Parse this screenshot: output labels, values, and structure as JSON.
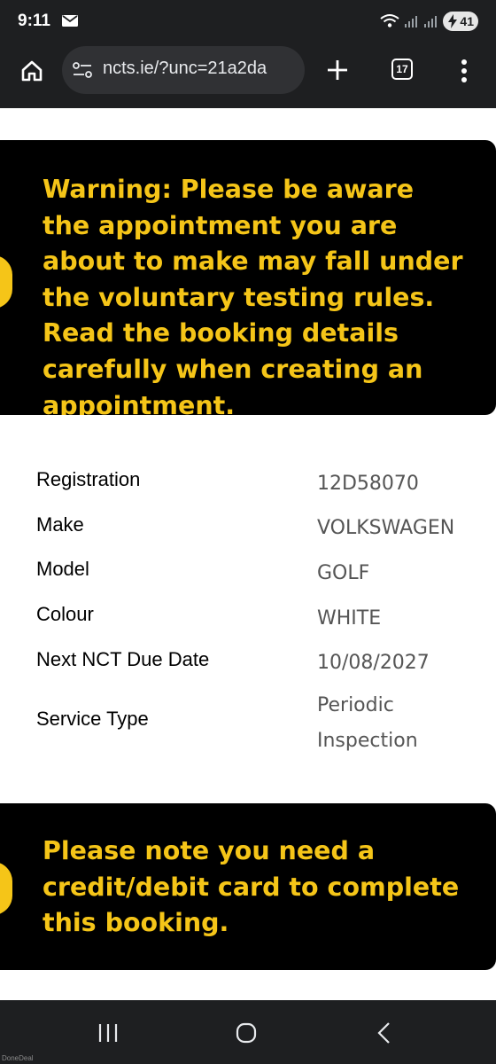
{
  "status_bar": {
    "time": "9:11",
    "battery": "41",
    "icons": [
      "mail-icon",
      "wifi-icon",
      "signal-icon",
      "signal-icon",
      "battery-icon"
    ]
  },
  "browser": {
    "url": "ncts.ie/?unc=21a2da",
    "tab_count": "17",
    "icons": [
      "home-icon",
      "site-settings-icon",
      "new-tab-icon",
      "tabs-counter",
      "menu-icon"
    ]
  },
  "warning": {
    "text": "Warning: Please be aware the appointment you are about to make may fall under the voluntary testing rules. Read the booking details carefully when creating an appointment."
  },
  "details": [
    {
      "label": "Registration",
      "value": "12D58070"
    },
    {
      "label": "Make",
      "value": "VOLKSWAGEN"
    },
    {
      "label": "Model",
      "value": "GOLF"
    },
    {
      "label": "Colour",
      "value": "WHITE"
    },
    {
      "label": "Next NCT Due Date",
      "value": "10/08/2027"
    },
    {
      "label": "Service Type",
      "value_line1": "Periodic",
      "value_line2": "Inspection"
    }
  ],
  "card_notice": {
    "text": "Please note you need a credit/debit card to complete this booking."
  },
  "watermark": "DoneDeal",
  "colors": {
    "accent": "#f5c518",
    "panel": "#000000",
    "chrome": "#1e1f21"
  }
}
